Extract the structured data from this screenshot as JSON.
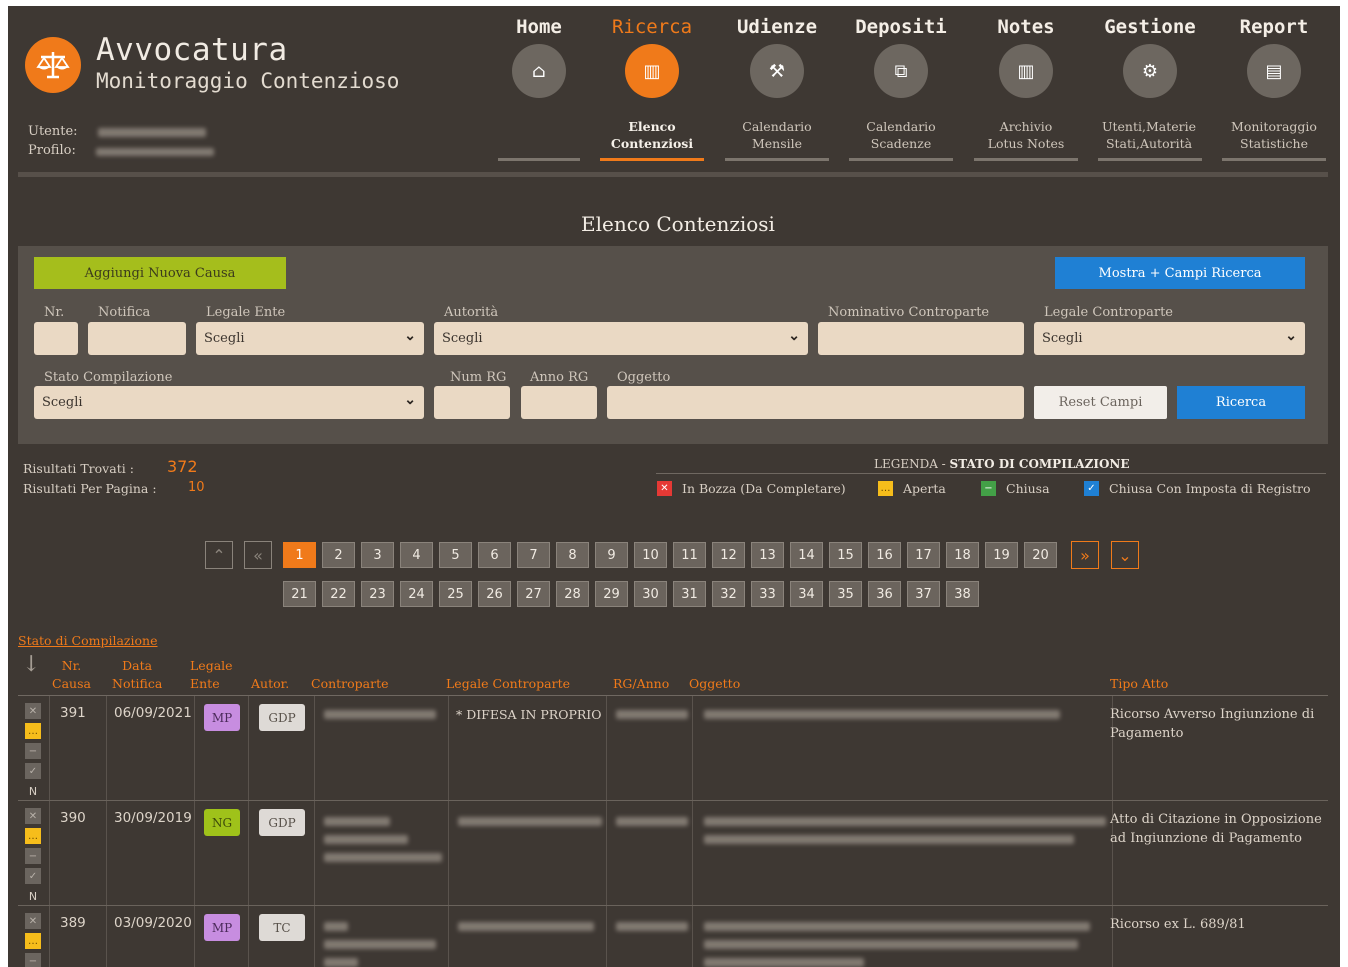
{
  "header": {
    "app_title": "Avvocatura",
    "app_subtitle": "Monitoraggio Contenzioso",
    "user_label": "Utente:",
    "profile_label": "Profilo:"
  },
  "nav": [
    {
      "label": "Home",
      "icon": "home-icon",
      "sub": ""
    },
    {
      "label": "Ricerca",
      "icon": "list-icon",
      "sub": "Elenco\nContenziosi"
    },
    {
      "label": "Udienze",
      "icon": "gavel-icon",
      "sub": "Calendario\nMensile"
    },
    {
      "label": "Depositi",
      "icon": "copy-icon",
      "sub": "Calendario\nScadenze"
    },
    {
      "label": "Notes",
      "icon": "notes-icon",
      "sub": "Archivio\nLotus Notes"
    },
    {
      "label": "Gestione",
      "icon": "gear-icon",
      "sub": "Utenti,Materie\nStati,Autorità"
    },
    {
      "label": "Report",
      "icon": "chart-icon",
      "sub": "Monitoraggio\nStatistiche"
    }
  ],
  "colors": {
    "accent": "#f07a1a",
    "background": "#3e3833",
    "panel": "#56504a",
    "blue": "#1f80d4",
    "green": "#a5be1c"
  },
  "page_title": "Elenco Contenziosi",
  "search": {
    "add_button": "Aggiungi Nuova Causa",
    "show_button": "Mostra + Campi Ricerca",
    "labels": {
      "nr": "Nr.",
      "notifica": "Notifica",
      "legale_ente": "Legale Ente",
      "autorita": "Autorità",
      "nominativo": "Nominativo Controparte",
      "legale_controparte": "Legale Controparte",
      "stato": "Stato Compilazione",
      "num_rg": "Num RG",
      "anno_rg": "Anno RG",
      "oggetto": "Oggetto"
    },
    "select_placeholder": "Scegli",
    "reset_button": "Reset Campi",
    "search_button": "Ricerca"
  },
  "results": {
    "found_label": "Risultati Trovati :",
    "found_value": "372",
    "per_page_label": "Risultati Per Pagina :",
    "per_page_value": "10"
  },
  "legend": {
    "title_prefix": "LEGENDA - ",
    "title_bold": "STATO DI COMPILAZIONE",
    "items": [
      {
        "label": "In Bozza (Da Completare)",
        "color": "#e53935",
        "glyph": "✕"
      },
      {
        "label": "Aperta",
        "color": "#f6bd1b",
        "glyph": "…"
      },
      {
        "label": "Chiusa",
        "color": "#43a047",
        "glyph": "−"
      },
      {
        "label": "Chiusa Con Imposta di Registro",
        "color": "#1f80d4",
        "glyph": "✓"
      }
    ]
  },
  "pagination": {
    "row1": [
      "1",
      "2",
      "3",
      "4",
      "5",
      "6",
      "7",
      "8",
      "9",
      "10",
      "11",
      "12",
      "13",
      "14",
      "15",
      "16",
      "17",
      "18",
      "19",
      "20"
    ],
    "row2": [
      "21",
      "22",
      "23",
      "24",
      "25",
      "26",
      "27",
      "28",
      "29",
      "30",
      "31",
      "32",
      "33",
      "34",
      "35",
      "36",
      "37",
      "38"
    ],
    "current": "1"
  },
  "table": {
    "stato_label": "Stato di Compilazione",
    "headers": {
      "nr": "Nr.\nCausa",
      "data": "Data\nNotifica",
      "legale": "Legale\nEnte",
      "autor": "Autor.",
      "controparte": "Controparte",
      "legale_controparte": "Legale Controparte",
      "rg": "RG/Anno",
      "oggetto": "Oggetto",
      "tipo": "Tipo Atto"
    },
    "rows": [
      {
        "nr": "391",
        "data": "06/09/2021",
        "legale": "MP",
        "autor": "GDP",
        "legale_controparte": "* DIFESA IN PROPRIO",
        "tipo": "Ricorso Avverso Ingiunzione di Pagamento"
      },
      {
        "nr": "390",
        "data": "30/09/2019",
        "legale": "NG",
        "autor": "GDP",
        "legale_controparte": "",
        "tipo": "Atto di Citazione in Opposizione ad Ingiunzione di Pagamento"
      },
      {
        "nr": "389",
        "data": "03/09/2020",
        "legale": "MP",
        "autor": "TC",
        "legale_controparte": "",
        "tipo": "Ricorso ex L. 689/81"
      }
    ],
    "status_glyphs": {
      "x": "✕",
      "y": "…",
      "g": "−",
      "c": "✓",
      "n": "N"
    }
  }
}
